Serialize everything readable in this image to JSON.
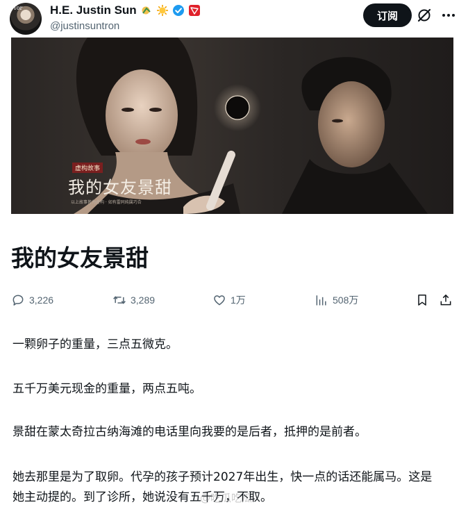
{
  "header": {
    "display_name": "H.E. Justin Sun",
    "handle": "@justinsuntron",
    "subscribe_label": "订阅",
    "avatar_mark": "Tor"
  },
  "cover": {
    "tag": "虚构故事",
    "title": "我的女友景甜",
    "subtitle": "以上故事皆为虚构 · 如有雷同纯属巧合"
  },
  "article": {
    "title": "我的女友景甜",
    "stats": {
      "replies": "3,226",
      "reposts": "3,289",
      "likes": "1万",
      "views": "508万"
    },
    "paragraphs": [
      "一颗卵子的重量，三点五微克。",
      "五千万美元现金的重量，两点五吨。",
      "景甜在蒙太奇拉古纳海滩的电话里向我要的是后者，抵押的是前者。",
      "她去那里是为了取卵。代孕的孩子预计2027年出生，快一点的话还能属马。这是她主动提的。到了诊所，她说没有五千万，不取。"
    ]
  },
  "watermark": "@吃瓜吃瓜",
  "colors": {
    "text": "#0f1419",
    "secondary": "#536471",
    "verified_blue": "#1d9bf0",
    "tron_red": "#e0212b",
    "button_bg": "#0f1419"
  },
  "icons": [
    "sun-badge-icon",
    "verified-badge-icon",
    "tron-badge-icon",
    "grok-icon",
    "more-icon",
    "reply-icon",
    "repost-icon",
    "like-icon",
    "views-icon",
    "bookmark-icon",
    "share-icon"
  ]
}
